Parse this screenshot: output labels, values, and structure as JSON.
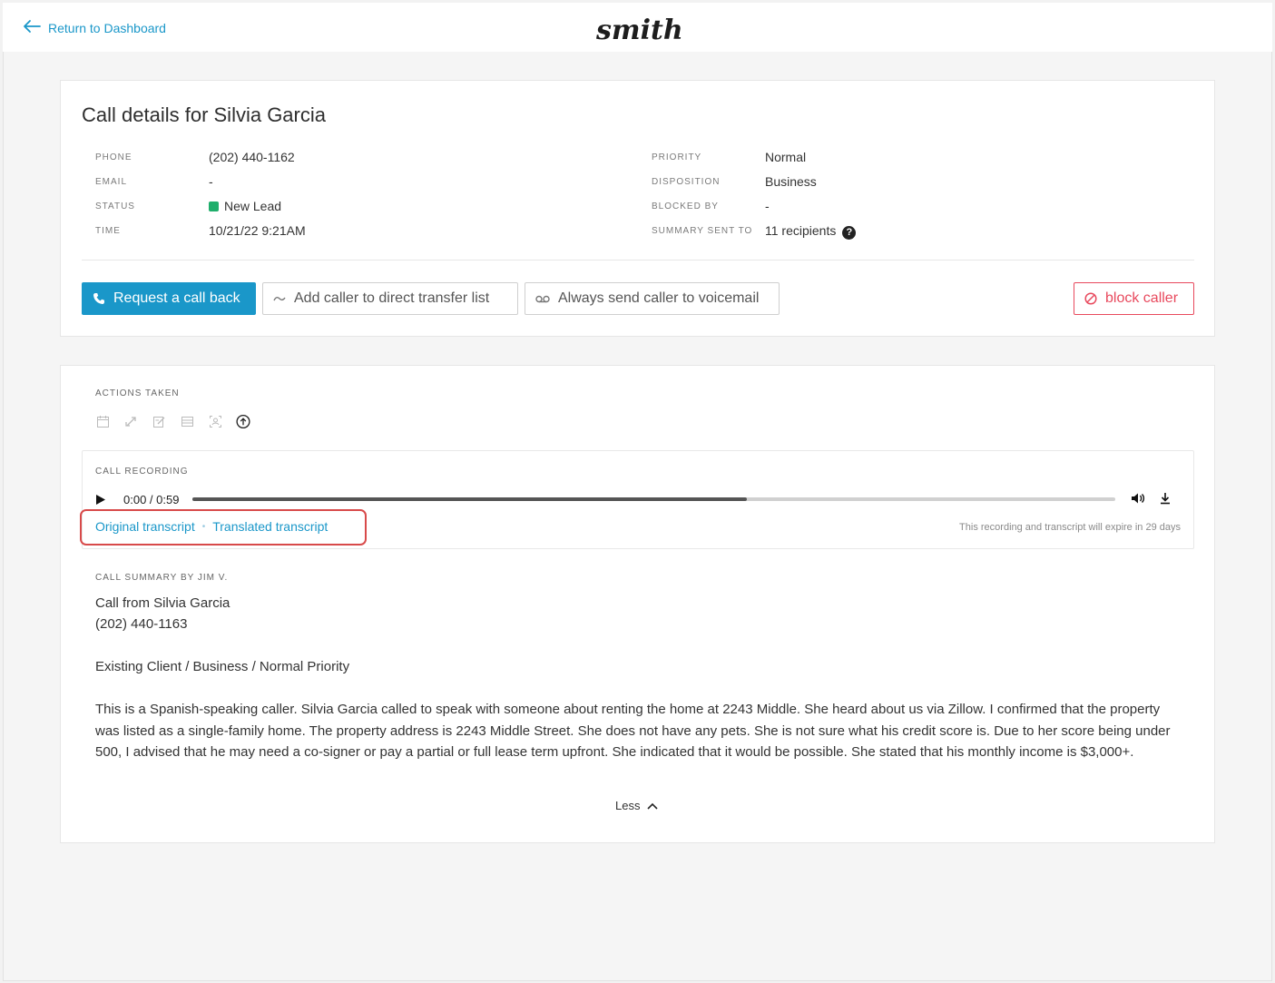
{
  "header": {
    "back_label": "Return to Dashboard",
    "logo_text": "smith"
  },
  "call": {
    "title": "Call details for Silvia Garcia",
    "left_fields": [
      {
        "label": "PHONE",
        "value": "(202) 440-1162"
      },
      {
        "label": "EMAIL",
        "value": "-"
      },
      {
        "label": "STATUS",
        "value": "New Lead"
      },
      {
        "label": "TIME",
        "value": "10/21/22 9:21AM"
      }
    ],
    "right_fields": [
      {
        "label": "PRIORITY",
        "value": "Normal"
      },
      {
        "label": "DISPOSITION",
        "value": "Business"
      },
      {
        "label": "BLOCKED BY",
        "value": "-"
      },
      {
        "label": "SUMMARY SENT TO",
        "value": "11 recipients"
      }
    ],
    "status_color": "#1fae6b",
    "help_glyph": "?"
  },
  "buttons": {
    "request_callback": "Request a call back",
    "add_transfer": "Add caller to direct transfer list",
    "send_voicemail": "Always send caller to voicemail",
    "block_caller": "block caller"
  },
  "actions": {
    "label": "ACTIONS TAKEN",
    "icons": [
      "calendar-icon",
      "transfer-icon",
      "edit-note-icon",
      "inbox-icon",
      "scan-contact-icon",
      "upload-circle-icon"
    ]
  },
  "recording": {
    "label": "CALL RECORDING",
    "time": "0:00 / 0:59",
    "progress": 0.6,
    "original_transcript": "Original transcript",
    "separator": "•",
    "translated_transcript": "Translated transcript",
    "expire_note": "This recording and transcript will expire in 29 days"
  },
  "summary": {
    "label": "CALL SUMMARY BY JIM V.",
    "line1": "Call from Silvia Garcia",
    "line2": "(202) 440-1163",
    "line3": "Existing Client / Business / Normal Priority",
    "body": "This is a Spanish-speaking caller. Silvia Garcia called to speak with someone about renting the home at 2243 Middle. She heard about us via Zillow. I confirmed that the property was listed as a single-family home. The property address is 2243 Middle Street. She does not have any pets. She is not sure what his credit score is. Due to her score being under 500, I advised that he may need a co-signer or pay a partial or full lease term upfront. She indicated that it would be possible. She stated that his monthly income is $3,000+.",
    "less_label": "Less"
  },
  "colors": {
    "accent": "#1a97c9",
    "danger": "#e8495d",
    "highlight": "#d84a4a"
  }
}
